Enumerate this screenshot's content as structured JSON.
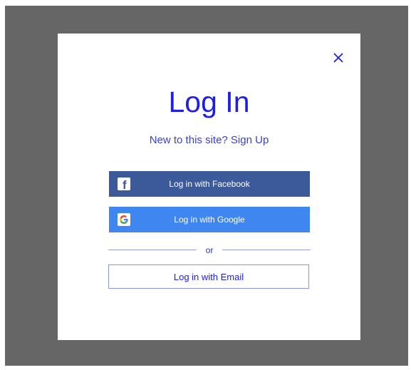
{
  "dialog": {
    "title": "Log In",
    "subtitle_text": "New to this site?",
    "signup_link": "Sign Up",
    "close_icon": "close-icon"
  },
  "buttons": {
    "facebook": {
      "label": "Log in with Facebook",
      "icon": "facebook-icon",
      "color": "#3c5a9a"
    },
    "google": {
      "label": "Log in with Google",
      "icon": "google-icon",
      "color": "#3f86f1"
    },
    "divider": "or",
    "email": {
      "label": "Log in with Email"
    }
  },
  "colors": {
    "accent": "#1e1ee8",
    "overlay": "#666666"
  }
}
